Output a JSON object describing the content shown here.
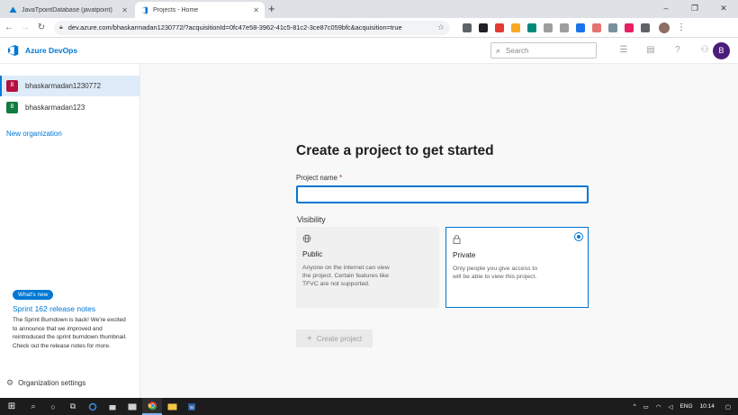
{
  "browser": {
    "tabs": [
      {
        "title": "JavaTpointDatabase (javatpoint)",
        "active": false
      },
      {
        "title": "Projects - Home",
        "active": true
      }
    ],
    "new_tab_symbol": "+",
    "window_controls": {
      "minimize": "–",
      "restore": "❐",
      "close": "✕"
    },
    "address": "dev.azure.com/bhaskarmadan1230772/?acquisitionId=0fc47e58-3962-41c5-81c2-3ce87c059bfc&acquisition=true",
    "extension_colors": [
      "#5f6368",
      "#202124",
      "#e53935",
      "#f9a825",
      "#00897b",
      "#9e9e9e",
      "#9e9e9e",
      "#1a73e8",
      "#e57373",
      "#78909c",
      "#e91e63",
      "#5f6368"
    ]
  },
  "header": {
    "brand": "Azure DevOps",
    "search_placeholder": "Search",
    "icons": [
      "list-icon",
      "bag-icon",
      "help-icon",
      "user-settings-icon"
    ],
    "user_initial": "B",
    "brand_color": "#0078d4"
  },
  "sidebar": {
    "orgs": [
      {
        "initial": "B",
        "name": "bhaskarmadan1230772",
        "color": "#b4103f",
        "selected": true
      },
      {
        "initial": "B",
        "name": "bhaskarmadan123",
        "color": "#107c41",
        "selected": false
      }
    ],
    "new_org": "New organization",
    "whats_new": "What's new",
    "release_title": "Sprint 162 release notes",
    "release_text": "The Sprint Burndown is back! We're excited to announce that we improved and reintroduced the sprint burndown thumbnail. Check out the release notes for more.",
    "settings": "Organization settings"
  },
  "main": {
    "title": "Create a project to get started",
    "project_name_label": "Project name",
    "required_mark": "*",
    "project_name_value": "",
    "visibility_label": "Visibility",
    "visibility": {
      "public": {
        "title": "Public",
        "desc": "Anyone on the internet can view the project. Certain features like TFVC are not supported."
      },
      "private": {
        "title": "Private",
        "desc": "Only people you give access to will be able to view this project.",
        "selected": true
      }
    },
    "create_button": "Create project"
  },
  "taskbar": {
    "tray_lang": "ENG",
    "time": "10:14"
  }
}
